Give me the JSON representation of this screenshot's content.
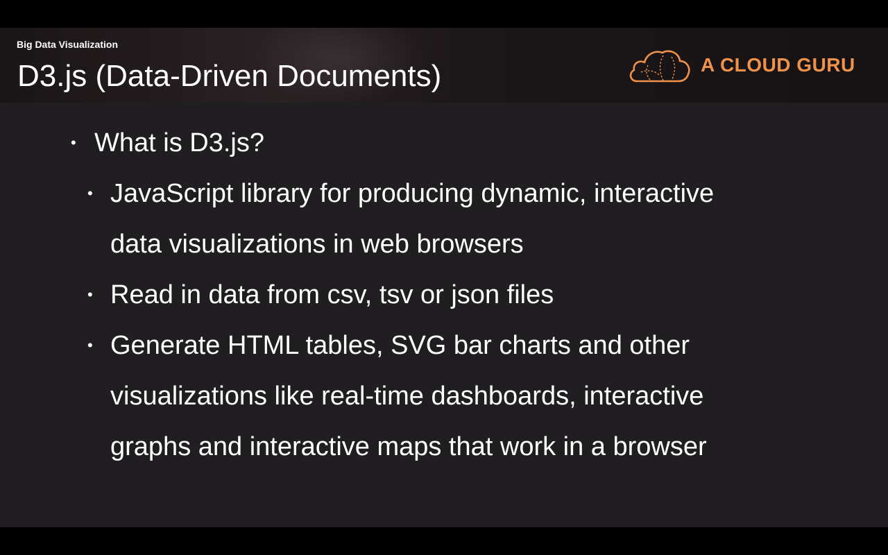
{
  "header": {
    "course_name": "Big Data Visualization",
    "slide_title": "D3.js (Data-Driven Documents)",
    "logo_text": "A CLOUD GURU",
    "logo_color": "#f0924a"
  },
  "content": {
    "bullets": [
      {
        "text": "What is D3.js?",
        "sub_bullets": [
          {
            "lines": [
              "JavaScript library for producing dynamic, interactive",
              "data visualizations in web browsers"
            ]
          },
          {
            "lines": [
              "Read in data from csv, tsv or json files"
            ]
          },
          {
            "lines": [
              "Generate HTML tables, SVG bar charts and other",
              "visualizations like real-time dashboards, interactive",
              "graphs and interactive maps that work in a browser"
            ]
          }
        ]
      }
    ]
  }
}
